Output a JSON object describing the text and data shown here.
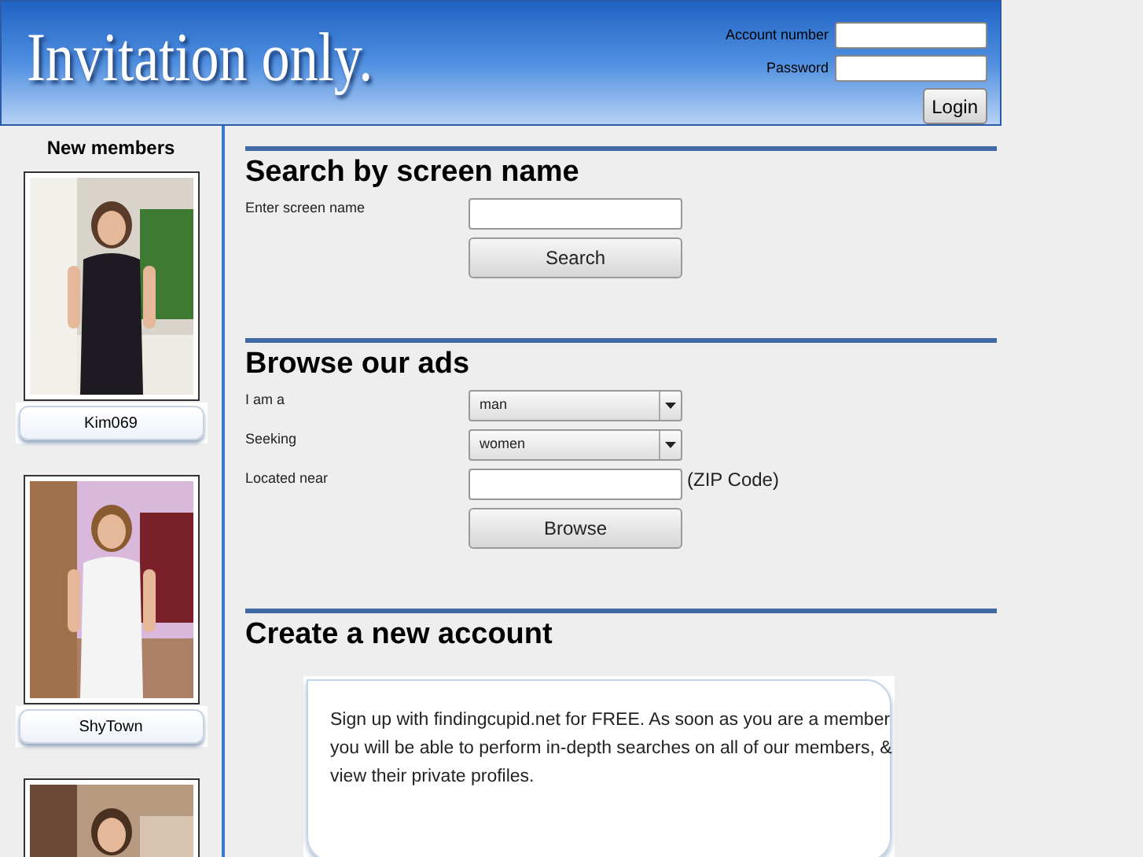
{
  "header": {
    "logo": "Invitation only.",
    "login": {
      "account_label": "Account number",
      "password_label": "Password",
      "button": "Login"
    }
  },
  "sidebar": {
    "title": "New members",
    "members": [
      {
        "kind": "picture",
        "name": "Kim069"
      },
      {
        "kind": "picture",
        "name": "ShyTown"
      },
      {
        "kind": "picture"
      }
    ]
  },
  "search": {
    "title": "Search by screen name",
    "field_label": "Enter screen name",
    "button": "Search"
  },
  "browse": {
    "title": "Browse our ads",
    "rows": [
      {
        "kind": "select",
        "label": "I am a",
        "value": "man"
      },
      {
        "kind": "select",
        "label": "Seeking",
        "value": "women"
      },
      {
        "kind": "input",
        "label": "Located near",
        "suffix": "(ZIP Code)"
      }
    ],
    "button": "Browse"
  },
  "signup": {
    "title": "Create a new account",
    "text": "Sign up with findingcupid.net for FREE. As soon as you are a member you will be able to perform in-depth searches on all of our members, & view their private profiles."
  }
}
